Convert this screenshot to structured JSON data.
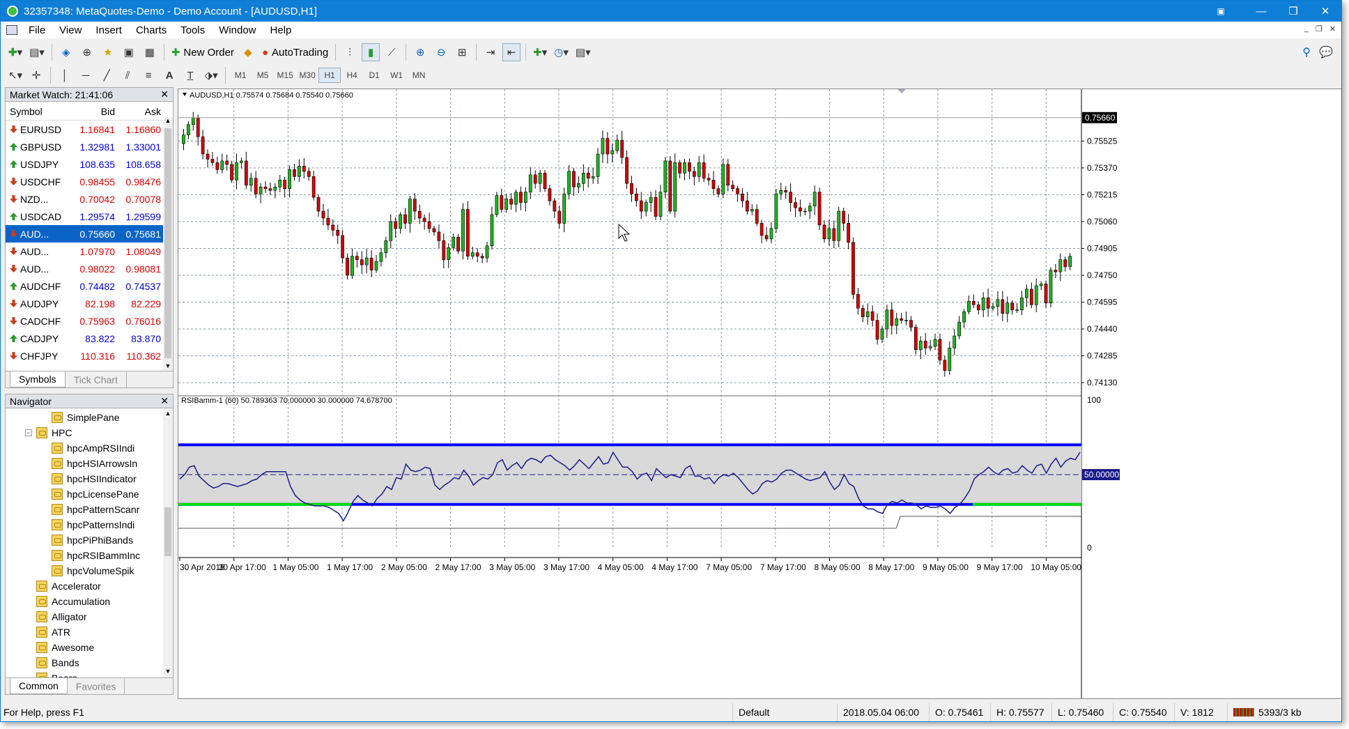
{
  "window": {
    "title": "32357348: MetaQuotes-Demo - Demo Account - [AUDUSD,H1]"
  },
  "menu": [
    "File",
    "View",
    "Insert",
    "Charts",
    "Tools",
    "Window",
    "Help"
  ],
  "toolbar": {
    "new_order": "New Order",
    "autotrading": "AutoTrading"
  },
  "timeframes": [
    "M1",
    "M5",
    "M15",
    "M30",
    "H1",
    "H4",
    "D1",
    "W1",
    "MN"
  ],
  "active_timeframe": "H1",
  "market_watch": {
    "title": "Market Watch: 21:41:06",
    "headers": {
      "symbol": "Symbol",
      "bid": "Bid",
      "ask": "Ask"
    },
    "rows": [
      {
        "symbol": "EURUSD",
        "bid": "1.16841",
        "ask": "1.16860",
        "dir": "down",
        "bidc": "red",
        "askc": "red"
      },
      {
        "symbol": "GBPUSD",
        "bid": "1.32981",
        "ask": "1.33001",
        "dir": "up",
        "bidc": "blue",
        "askc": "blue"
      },
      {
        "symbol": "USDJPY",
        "bid": "108.635",
        "ask": "108.658",
        "dir": "up",
        "bidc": "blue",
        "askc": "blue"
      },
      {
        "symbol": "USDCHF",
        "bid": "0.98455",
        "ask": "0.98476",
        "dir": "down",
        "bidc": "red",
        "askc": "red"
      },
      {
        "symbol": "NZD...",
        "bid": "0.70042",
        "ask": "0.70078",
        "dir": "down",
        "bidc": "red",
        "askc": "red"
      },
      {
        "symbol": "USDCAD",
        "bid": "1.29574",
        "ask": "1.29599",
        "dir": "up",
        "bidc": "blue",
        "askc": "blue"
      },
      {
        "symbol": "AUD...",
        "bid": "0.75660",
        "ask": "0.75681",
        "dir": "down",
        "bidc": "red",
        "askc": "red",
        "selected": true
      },
      {
        "symbol": "AUD...",
        "bid": "1.07970",
        "ask": "1.08049",
        "dir": "down",
        "bidc": "red",
        "askc": "red"
      },
      {
        "symbol": "AUD...",
        "bid": "0.98022",
        "ask": "0.98081",
        "dir": "down",
        "bidc": "red",
        "askc": "red"
      },
      {
        "symbol": "AUDCHF",
        "bid": "0.74482",
        "ask": "0.74537",
        "dir": "up",
        "bidc": "blue",
        "askc": "blue"
      },
      {
        "symbol": "AUDJPY",
        "bid": "82.198",
        "ask": "82.229",
        "dir": "down",
        "bidc": "red",
        "askc": "red"
      },
      {
        "symbol": "CADCHF",
        "bid": "0.75963",
        "ask": "0.76016",
        "dir": "down",
        "bidc": "red",
        "askc": "red"
      },
      {
        "symbol": "CADJPY",
        "bid": "83.822",
        "ask": "83.870",
        "dir": "up",
        "bidc": "blue",
        "askc": "blue"
      },
      {
        "symbol": "CHFJPY",
        "bid": "110.316",
        "ask": "110.362",
        "dir": "down",
        "bidc": "red",
        "askc": "red"
      }
    ],
    "tabs": [
      "Symbols",
      "Tick Chart"
    ]
  },
  "navigator": {
    "title": "Navigator",
    "items": [
      {
        "label": "SimplePane",
        "level": 3
      },
      {
        "label": "HPC",
        "level": 2,
        "expandable": true
      },
      {
        "label": "hpcAmpRSIIndi",
        "level": 3
      },
      {
        "label": "hpcHSIArrowsIn",
        "level": 3
      },
      {
        "label": "hpcHSIIndicator",
        "level": 3
      },
      {
        "label": "hpcLicensePane",
        "level": 3
      },
      {
        "label": "hpcPatternScanr",
        "level": 3
      },
      {
        "label": "hpcPatternsIndi",
        "level": 3
      },
      {
        "label": "hpcPiPhiBands",
        "level": 3
      },
      {
        "label": "hpcRSIBammInc",
        "level": 3
      },
      {
        "label": "hpcVolumeSpik",
        "level": 3
      },
      {
        "label": "Accelerator",
        "level": 2
      },
      {
        "label": "Accumulation",
        "level": 2
      },
      {
        "label": "Alligator",
        "level": 2
      },
      {
        "label": "ATR",
        "level": 2
      },
      {
        "label": "Awesome",
        "level": 2
      },
      {
        "label": "Bands",
        "level": 2
      },
      {
        "label": "Bears",
        "level": 2
      }
    ],
    "tabs": [
      "Common",
      "Favorites"
    ]
  },
  "chart_data": [
    {
      "type": "candlestick",
      "title": "AUDUSD,H1  0.75574 0.75684 0.75540 0.75660",
      "symbol": "AUDUSD",
      "timeframe": "H1",
      "last_price": "0.75660",
      "ylim": [
        0.7407,
        0.758
      ],
      "y_ticks": [
        "0.75525",
        "0.75370",
        "0.75215",
        "0.75060",
        "0.74905",
        "0.74750",
        "0.74595",
        "0.74440",
        "0.74285",
        "0.74130"
      ],
      "x_ticks": [
        "30 Apr 2018",
        "30 Apr 17:00",
        "1 May 05:00",
        "1 May 17:00",
        "2 May 05:00",
        "2 May 17:00",
        "3 May 05:00",
        "3 May 17:00",
        "4 May 05:00",
        "4 May 17:00",
        "7 May 05:00",
        "7 May 17:00",
        "8 May 05:00",
        "8 May 17:00",
        "9 May 05:00",
        "9 May 17:00",
        "10 May 05:00"
      ],
      "close": [
        0.7556,
        0.7562,
        0.7566,
        0.7555,
        0.7545,
        0.7542,
        0.754,
        0.7536,
        0.7541,
        0.7539,
        0.753,
        0.754,
        0.7541,
        0.7527,
        0.7531,
        0.7522,
        0.7526,
        0.7525,
        0.7524,
        0.7526,
        0.753,
        0.7525,
        0.7536,
        0.7532,
        0.7538,
        0.7535,
        0.7532,
        0.752,
        0.7512,
        0.7508,
        0.7504,
        0.7501,
        0.7498,
        0.7485,
        0.7475,
        0.7486,
        0.7484,
        0.7481,
        0.7485,
        0.7478,
        0.7483,
        0.7488,
        0.7495,
        0.7506,
        0.7502,
        0.751,
        0.7505,
        0.7519,
        0.7512,
        0.7508,
        0.7506,
        0.7502,
        0.75,
        0.7495,
        0.7484,
        0.7491,
        0.7497,
        0.7489,
        0.7513,
        0.7486,
        0.7488,
        0.7486,
        0.7485,
        0.7492,
        0.751,
        0.7521,
        0.7513,
        0.7519,
        0.7516,
        0.7523,
        0.7517,
        0.7523,
        0.7533,
        0.7528,
        0.7534,
        0.7525,
        0.7518,
        0.7512,
        0.7505,
        0.7522,
        0.7535,
        0.7526,
        0.7528,
        0.7534,
        0.7531,
        0.7532,
        0.7545,
        0.7554,
        0.7545,
        0.7547,
        0.7553,
        0.7543,
        0.7528,
        0.7522,
        0.7518,
        0.7512,
        0.7517,
        0.752,
        0.7509,
        0.7523,
        0.7541,
        0.7512,
        0.754,
        0.7534,
        0.754,
        0.7535,
        0.7532,
        0.754,
        0.7531,
        0.753,
        0.7525,
        0.7522,
        0.7539,
        0.7527,
        0.7525,
        0.7522,
        0.7518,
        0.7512,
        0.7513,
        0.7505,
        0.7498,
        0.7496,
        0.7502,
        0.7522,
        0.7524,
        0.7523,
        0.7517,
        0.7514,
        0.7512,
        0.7512,
        0.7515,
        0.7523,
        0.7504,
        0.7496,
        0.7502,
        0.7495,
        0.7512,
        0.7505,
        0.7494,
        0.7464,
        0.7456,
        0.7451,
        0.7454,
        0.7449,
        0.7438,
        0.7444,
        0.7455,
        0.7446,
        0.745,
        0.7449,
        0.7449,
        0.7445,
        0.7432,
        0.7437,
        0.7433,
        0.7434,
        0.7438,
        0.7426,
        0.742,
        0.7433,
        0.744,
        0.7448,
        0.7454,
        0.746,
        0.7458,
        0.7455,
        0.7462,
        0.7456,
        0.7457,
        0.7461,
        0.7453,
        0.7459,
        0.7455,
        0.7455,
        0.7462,
        0.7467,
        0.7458,
        0.7469,
        0.747,
        0.7459,
        0.7478,
        0.7477,
        0.7484,
        0.748,
        0.7486
      ]
    },
    {
      "type": "line",
      "title": "RSIBamm-1 (60) 50.789363 70.000000 30.000000 74.678700",
      "ylim": [
        0,
        100
      ],
      "y_ticks": [
        "100",
        "50.00000",
        "0"
      ],
      "levels": [
        70,
        50,
        30
      ],
      "values": [
        47,
        50,
        55,
        56,
        49,
        46,
        43,
        41,
        42,
        44,
        44,
        43,
        42,
        43,
        44,
        46,
        47,
        50,
        52,
        52,
        52,
        52,
        52,
        42,
        36,
        33,
        31,
        30,
        29,
        29,
        29,
        28,
        26,
        24,
        19,
        25,
        32,
        36,
        33,
        31,
        29,
        34,
        37,
        42,
        40,
        48,
        47,
        57,
        53,
        52,
        53,
        55,
        54,
        43,
        40,
        43,
        45,
        48,
        47,
        53,
        49,
        43,
        46,
        48,
        47,
        50,
        58,
        60,
        53,
        56,
        58,
        54,
        59,
        61,
        60,
        58,
        62,
        63,
        60,
        58,
        56,
        53,
        56,
        60,
        57,
        54,
        58,
        62,
        57,
        58,
        65,
        60,
        55,
        55,
        52,
        47,
        50,
        51,
        46,
        54,
        51,
        48,
        50,
        49,
        48,
        54,
        56,
        49,
        49,
        47,
        48,
        44,
        48,
        50,
        49,
        51,
        48,
        44,
        40,
        37,
        39,
        44,
        46,
        45,
        47,
        51,
        53,
        53,
        51,
        49,
        47,
        46,
        47,
        48,
        52,
        45,
        40,
        43,
        50,
        44,
        42,
        34,
        29,
        27,
        27,
        25,
        24,
        30,
        32,
        31,
        33,
        31,
        31,
        30,
        27,
        29,
        28,
        28,
        29,
        27,
        24,
        28,
        30,
        34,
        39,
        47,
        50,
        52,
        55,
        52,
        50,
        53,
        54,
        51,
        52,
        56,
        53,
        51,
        56,
        57,
        51,
        57,
        61,
        55,
        59,
        61,
        60,
        65
      ]
    }
  ],
  "status": {
    "help": "For Help, press F1",
    "profile": "Default",
    "datetime": "2018.05.04 06:00",
    "open": "O: 0.75461",
    "high": "H: 0.75577",
    "low": "L: 0.75460",
    "close": "C: 0.75540",
    "volume": "V: 1812",
    "traffic": "5393/3 kb"
  },
  "colors": {
    "bull": "#1fb51f",
    "bear": "#d40000",
    "rsi_level": "#0000ff",
    "rsi_green": "#00e000",
    "rsi_line": "#1a1a8c",
    "grid": "#8899aa"
  }
}
